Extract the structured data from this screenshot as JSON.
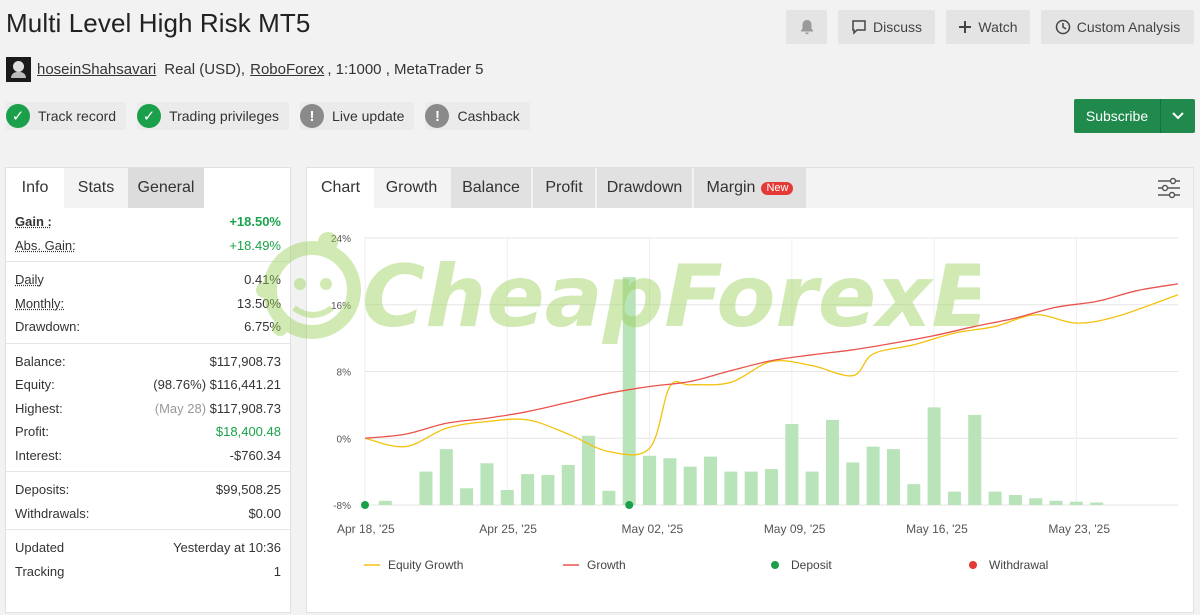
{
  "header": {
    "title": "Multi Level High Risk MT5",
    "discuss_label": "Discuss",
    "watch_label": "Watch",
    "custom_label": "Custom Analysis"
  },
  "account": {
    "username": "hoseinShahsavari",
    "type": "Real (USD),",
    "broker": "RoboForex",
    "leverage": ", 1:1000 , MetaTrader 5"
  },
  "badges": [
    {
      "label": "Track record",
      "status": "ok"
    },
    {
      "label": "Trading privileges",
      "status": "ok"
    },
    {
      "label": "Live update",
      "status": "warn"
    },
    {
      "label": "Cashback",
      "status": "warn"
    }
  ],
  "subscribe_label": "Subscribe",
  "left_tabs": {
    "info": "Info",
    "stats": "Stats",
    "general": "General"
  },
  "stats": {
    "gain": {
      "label": "Gain :",
      "value": "+18.50%"
    },
    "abs_gain": {
      "label": "Abs. Gain:",
      "value": "+18.49%"
    },
    "daily": {
      "label": "Daily",
      "value": "0.41%"
    },
    "monthly": {
      "label": "Monthly:",
      "value": "13.50%"
    },
    "drawdown": {
      "label": "Drawdown:",
      "value": "6.75%"
    },
    "balance": {
      "label": "Balance:",
      "value": "$117,908.73"
    },
    "equity": {
      "label": "Equity:",
      "note": "(98.76%)",
      "value": "$116,441.21"
    },
    "highest": {
      "label": "Highest:",
      "note": "(May 28)",
      "value": "$117,908.73"
    },
    "profit": {
      "label": "Profit:",
      "value": "$18,400.48"
    },
    "interest": {
      "label": "Interest:",
      "value": "-$760.34"
    },
    "deposits": {
      "label": "Deposits:",
      "value": "$99,508.25"
    },
    "withdrawals": {
      "label": "Withdrawals:",
      "value": "$0.00"
    },
    "updated": {
      "label": "Updated",
      "value": "Yesterday at 10:36"
    },
    "tracking": {
      "label": "Tracking",
      "value": "1"
    }
  },
  "chart_tabs": {
    "chart": "Chart",
    "growth": "Growth",
    "balance": "Balance",
    "profit": "Profit",
    "drawdown": "Drawdown",
    "margin": "Margin",
    "new_tag": "New"
  },
  "watermark": "CheapForexEa",
  "chart_data": {
    "type": "line",
    "ylim": [
      -8,
      24
    ],
    "yticks": [
      "24%",
      "16%",
      "8%",
      "0%",
      "-8%"
    ],
    "ytick_values": [
      24,
      16,
      8,
      0,
      -8
    ],
    "x_range": [
      "2025-04-18",
      "2025-05-28"
    ],
    "xticks": [
      {
        "label": "Apr 18, '25",
        "date": "2025-04-18"
      },
      {
        "label": "Apr 25, '25",
        "date": "2025-04-25"
      },
      {
        "label": "May 02, '25",
        "date": "2025-05-02"
      },
      {
        "label": "May 09, '25",
        "date": "2025-05-09"
      },
      {
        "label": "May 16, '25",
        "date": "2025-05-16"
      },
      {
        "label": "May 23, '25",
        "date": "2025-05-23"
      }
    ],
    "bar_series": {
      "dates": [
        "2025-04-19",
        "2025-04-21",
        "2025-04-22",
        "2025-04-23",
        "2025-04-24",
        "2025-04-25",
        "2025-04-26",
        "2025-04-27",
        "2025-04-28",
        "2025-04-29",
        "2025-04-30",
        "2025-05-01",
        "2025-05-02",
        "2025-05-03",
        "2025-05-04",
        "2025-05-05",
        "2025-05-06",
        "2025-05-07",
        "2025-05-08",
        "2025-05-09",
        "2025-05-10",
        "2025-05-11",
        "2025-05-12",
        "2025-05-13",
        "2025-05-14",
        "2025-05-15",
        "2025-05-16",
        "2025-05-17",
        "2025-05-18",
        "2025-05-19",
        "2025-05-20",
        "2025-05-21",
        "2025-05-22",
        "2025-05-23",
        "2025-05-24"
      ],
      "values": [
        -7.5,
        -4,
        -1.3,
        -6,
        -3,
        -6.2,
        -4.3,
        -4.4,
        -3.2,
        0.3,
        -6.3,
        19.3,
        -2.1,
        -2.4,
        -3.4,
        -2.2,
        -4,
        -4,
        -3.7,
        1.7,
        -4,
        2.2,
        -2.9,
        -1,
        -1.3,
        -5.5,
        3.7,
        -6.4,
        2.8,
        -6.4,
        -6.8,
        -7.2,
        -7.5,
        -7.6,
        -7.7
      ]
    },
    "series": [
      {
        "name": "Equity Growth",
        "color": "#f4c20d",
        "dates": [
          "2025-04-18",
          "2025-04-20",
          "2025-04-22",
          "2025-04-24",
          "2025-04-26",
          "2025-04-28",
          "2025-04-30",
          "2025-05-02",
          "2025-05-03",
          "2025-05-04",
          "2025-05-06",
          "2025-05-08",
          "2025-05-10",
          "2025-05-12",
          "2025-05-13",
          "2025-05-15",
          "2025-05-17",
          "2025-05-19",
          "2025-05-21",
          "2025-05-23",
          "2025-05-25",
          "2025-05-28"
        ],
        "values": [
          0,
          -1,
          1.2,
          2,
          2.2,
          0.5,
          -1.6,
          -1.2,
          6.2,
          6.4,
          6.7,
          9.2,
          8.7,
          7.5,
          10.1,
          11.2,
          12.6,
          13.4,
          14.8,
          13.8,
          14.6,
          17.2
        ]
      },
      {
        "name": "Growth",
        "color": "#e9534b",
        "dates": [
          "2025-04-18",
          "2025-04-20",
          "2025-04-22",
          "2025-04-24",
          "2025-04-26",
          "2025-04-28",
          "2025-04-30",
          "2025-05-02",
          "2025-05-04",
          "2025-05-06",
          "2025-05-08",
          "2025-05-10",
          "2025-05-12",
          "2025-05-14",
          "2025-05-16",
          "2025-05-18",
          "2025-05-20",
          "2025-05-22",
          "2025-05-24",
          "2025-05-26",
          "2025-05-28"
        ],
        "values": [
          0,
          0.5,
          1.8,
          2.4,
          3.2,
          4.3,
          5.4,
          6.2,
          6.8,
          8.1,
          9.3,
          10,
          10.6,
          11.4,
          12.3,
          13.4,
          14.4,
          15.7,
          16.4,
          17.7,
          18.5
        ]
      }
    ],
    "markers": [
      {
        "name": "Deposit",
        "color": "#1a9f4a",
        "dates": [
          "2025-04-18",
          "2025-05-01"
        ],
        "value": -8
      }
    ],
    "legend": [
      {
        "name": "Equity Growth",
        "color": "#f4c20d",
        "kind": "line"
      },
      {
        "name": "Growth",
        "color": "#e9534b",
        "kind": "line"
      },
      {
        "name": "Deposit",
        "color": "#1a9f4a",
        "kind": "dot"
      },
      {
        "name": "Withdrawal",
        "color": "#e53935",
        "kind": "dot"
      }
    ],
    "legend_position": "bottom",
    "grid": true
  }
}
